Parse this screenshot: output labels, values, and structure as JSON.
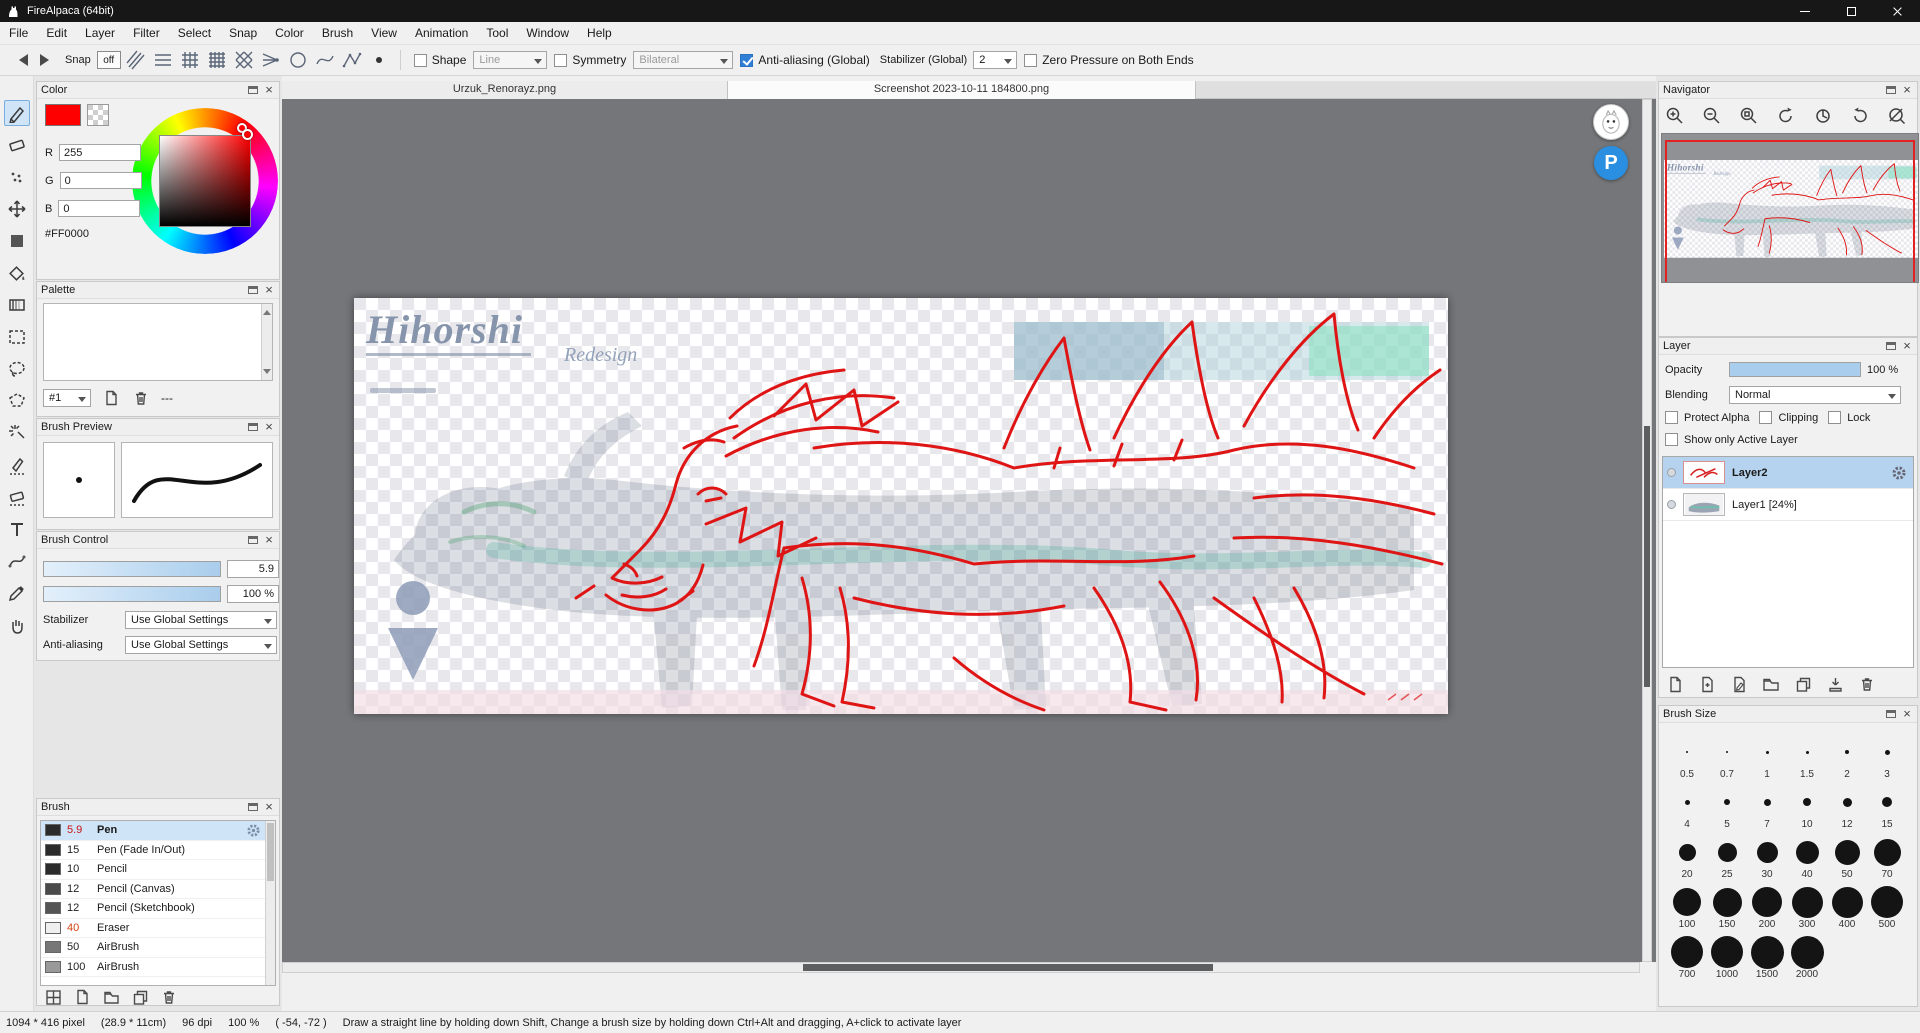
{
  "window": {
    "title": "FireAlpaca (64bit)"
  },
  "menu": {
    "items": [
      "File",
      "Edit",
      "Layer",
      "Filter",
      "Select",
      "Snap",
      "Color",
      "Brush",
      "View",
      "Animation",
      "Tool",
      "Window",
      "Help"
    ]
  },
  "toolbar": {
    "snap_label": "Snap",
    "snap_off_label": "off",
    "shape_label": "Shape",
    "shape_value": "Line",
    "symmetry_label": "Symmetry",
    "symmetry_value": "Bilateral",
    "antialias_label": "Anti-aliasing (Global)",
    "stabilizer_label": "Stabilizer (Global)",
    "stabilizer_value": "2",
    "zero_pressure_label": "Zero Pressure on Both Ends"
  },
  "tabs": {
    "items": [
      {
        "label": "Urzuk_Renorayz.png",
        "active": false
      },
      {
        "label": "Screenshot 2023-10-11 184800.png",
        "active": true
      }
    ]
  },
  "color_panel": {
    "title": "Color",
    "r_label": "R",
    "r_value": "255",
    "g_label": "G",
    "g_value": "0",
    "b_label": "B",
    "b_value": "0",
    "hex_value": "#FF0000",
    "selected_color": "#FF0000"
  },
  "palette_panel": {
    "title": "Palette",
    "slot_value": "#1",
    "more_label": "---"
  },
  "brush_preview_panel": {
    "title": "Brush Preview"
  },
  "brush_control_panel": {
    "title": "Brush Control",
    "size_value": "5.9",
    "opacity_value": "100 %",
    "stabilizer_label": "Stabilizer",
    "stabilizer_value": "Use Global Settings",
    "antialias_label": "Anti-aliasing",
    "antialias_value": "Use Global Settings"
  },
  "brush_panel": {
    "title": "Brush",
    "items": [
      {
        "size": "5.9",
        "name": "Pen",
        "size_color": "#c81414",
        "selected": true
      },
      {
        "size": "15",
        "name": "Pen (Fade In/Out)",
        "size_color": "#222222",
        "selected": false
      },
      {
        "size": "10",
        "name": "Pencil",
        "size_color": "#222222",
        "selected": false
      },
      {
        "size": "12",
        "name": "Pencil (Canvas)",
        "size_color": "#222222",
        "selected": false
      },
      {
        "size": "12",
        "name": "Pencil (Sketchbook)",
        "size_color": "#222222",
        "selected": false
      },
      {
        "size": "40",
        "name": "Eraser",
        "size_color": "#d04414",
        "selected": false
      },
      {
        "size": "50",
        "name": "AirBrush",
        "size_color": "#222222",
        "selected": false
      },
      {
        "size": "100",
        "name": "AirBrush",
        "size_color": "#222222",
        "selected": false
      }
    ]
  },
  "navigator_panel": {
    "title": "Navigator"
  },
  "layer_panel": {
    "title": "Layer",
    "opacity_label": "Opacity",
    "opacity_value": "100 %",
    "blending_label": "Blending",
    "blending_value": "Normal",
    "protect_alpha_label": "Protect Alpha",
    "clipping_label": "Clipping",
    "lock_label": "Lock",
    "show_only_label": "Show only Active Layer",
    "layers": [
      {
        "name": "Layer2",
        "selected": true
      },
      {
        "name": "Layer1 [24%]",
        "selected": false
      }
    ]
  },
  "brush_size_panel": {
    "title": "Brush Size",
    "sizes": [
      {
        "label": "0.5",
        "d": 2
      },
      {
        "label": "0.7",
        "d": 2
      },
      {
        "label": "1",
        "d": 3
      },
      {
        "label": "1.5",
        "d": 3
      },
      {
        "label": "2",
        "d": 4
      },
      {
        "label": "3",
        "d": 5
      },
      {
        "label": "4",
        "d": 5
      },
      {
        "label": "5",
        "d": 6
      },
      {
        "label": "7",
        "d": 7
      },
      {
        "label": "10",
        "d": 8
      },
      {
        "label": "12",
        "d": 9
      },
      {
        "label": "15",
        "d": 10
      },
      {
        "label": "20",
        "d": 17
      },
      {
        "label": "25",
        "d": 19
      },
      {
        "label": "30",
        "d": 21
      },
      {
        "label": "40",
        "d": 23
      },
      {
        "label": "50",
        "d": 25
      },
      {
        "label": "70",
        "d": 27
      },
      {
        "label": "100",
        "d": 28
      },
      {
        "label": "150",
        "d": 29
      },
      {
        "label": "200",
        "d": 30
      },
      {
        "label": "300",
        "d": 31
      },
      {
        "label": "400",
        "d": 31
      },
      {
        "label": "500",
        "d": 32
      },
      {
        "label": "700",
        "d": 32
      },
      {
        "label": "1000",
        "d": 32
      },
      {
        "label": "1500",
        "d": 33
      },
      {
        "label": "2000",
        "d": 33
      }
    ]
  },
  "canvas": {
    "artwork_title": "Hihorshi",
    "artwork_subtitle": "Redesign",
    "p_badge_label": "P"
  },
  "status_bar": {
    "dimensions": "1094 * 416 pixel",
    "physical_size": "(28.9 * 11cm)",
    "dpi": "96 dpi",
    "zoom": "100 %",
    "coordinates": "( -54, -72 )",
    "hint": "Draw a straight line by holding down Shift, Change a brush size by holding down Ctrl+Alt and dragging, A+click to activate layer"
  },
  "glyphs": {
    "close": "×"
  }
}
